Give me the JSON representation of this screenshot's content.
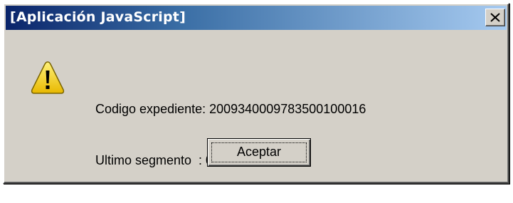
{
  "dialog": {
    "title": "[Aplicación JavaScript]",
    "close_glyph": "✕",
    "icon": "warning-icon",
    "message_line1": "Codigo expediente: 2009340009783500100016",
    "message_line2": "Ultimo segmento  : 0",
    "ok_label": "Aceptar"
  },
  "colors": {
    "titlebar_start": "#0a246a",
    "titlebar_end": "#a6caf0",
    "dialog_bg": "#d4d0c8",
    "warning_yellow": "#f8d200"
  }
}
